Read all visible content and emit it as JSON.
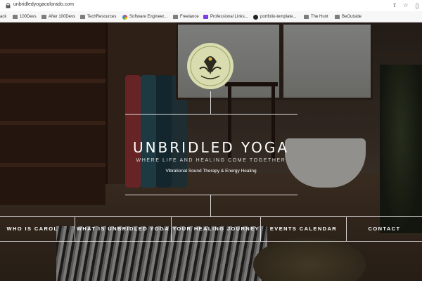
{
  "browser": {
    "url": "unbridledyogacolorado.com",
    "bookmarks": [
      {
        "label": "ack",
        "icon": "none"
      },
      {
        "label": "100Devs",
        "icon": "folder-icon"
      },
      {
        "label": "After 100Devs",
        "icon": "folder-icon"
      },
      {
        "label": "TechResources",
        "icon": "folder-icon"
      },
      {
        "label": "Software Engineer...",
        "icon": "google-icon"
      },
      {
        "label": "Freelance",
        "icon": "folder-icon"
      },
      {
        "label": "Professional Links...",
        "icon": "purple-app-icon"
      },
      {
        "label": "portfolio-template...",
        "icon": "github-icon"
      },
      {
        "label": "The Hunt",
        "icon": "folder-icon"
      },
      {
        "label": "BeOutside",
        "icon": "folder-icon"
      }
    ]
  },
  "hero": {
    "title": "UNBRIDLED YOGA",
    "tagline": "WHERE LIFE AND HEALING COME TOGETHER",
    "subtitle": "Vibrational Sound Therapy & Energy Healing"
  },
  "nav": {
    "items": [
      {
        "label": "WHO IS CAROL"
      },
      {
        "label": "WHAT IS UNBRIDLED YOGA"
      },
      {
        "label": "YOUR HEALING JOURNEY"
      },
      {
        "label": "EVENTS CALENDAR"
      },
      {
        "label": "CONTACT"
      }
    ]
  },
  "colors": {
    "logo_circle": "#d9dcae",
    "logo_ink": "#2a2a1e",
    "text": "#ffffff"
  }
}
